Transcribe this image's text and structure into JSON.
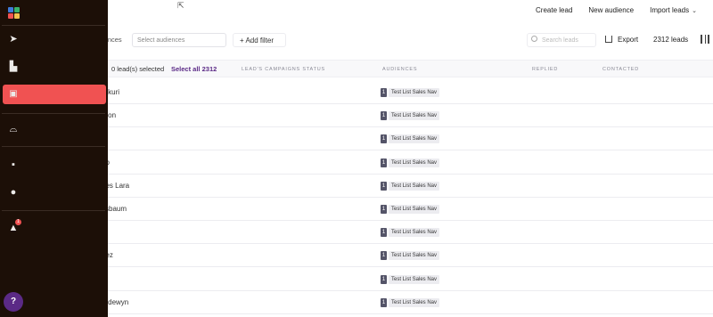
{
  "header": {
    "create_lead": "Create lead",
    "new_audience": "New audience",
    "import_leads": "Import leads"
  },
  "filters": {
    "audiences_tab": "iences",
    "select_placeholder": "Select audiences",
    "add_filter": "+ Add filter",
    "search_placeholder": "Search leads",
    "export": "Export",
    "lead_count": "2312 leads"
  },
  "table": {
    "selected_text": "0 lead(s) selected",
    "select_all": "Select all 2312",
    "columns": [
      "LEAD'S CAMPAIGNS STATUS",
      "AUDIENCES",
      "REPLIED",
      "CONTACTED"
    ],
    "rows": [
      {
        "name": "rukuri",
        "audience_count": "1",
        "audience": "Test List Sales Nav"
      },
      {
        "name": "oron",
        "audience_count": "1",
        "audience": "Test List Sales Nav"
      },
      {
        "name": "s",
        "audience_count": "1",
        "audience": "Test List Sales Nav"
      },
      {
        "name": "ho",
        "audience_count": "1",
        "audience": "Test List Sales Nav"
      },
      {
        "name": "ees Lara",
        "audience_count": "1",
        "audience": "Test List Sales Nav"
      },
      {
        "name": "ssbaum",
        "audience_count": "1",
        "audience": "Test List Sales Nav"
      },
      {
        "name": "e",
        "audience_count": "1",
        "audience": "Test List Sales Nav"
      },
      {
        "name": "dez",
        "audience_count": "1",
        "audience": "Test List Sales Nav"
      },
      {
        "name": "er",
        "audience_count": "1",
        "audience": "Test List Sales Nav"
      },
      {
        "name": "erdewyn",
        "audience_count": "1",
        "audience": "Test List Sales Nav"
      }
    ]
  },
  "sidebar": {
    "icons": [
      "logo-icon",
      "send-icon",
      "chart-icon",
      "contacts-icon",
      "inbox-icon",
      "bot-icon",
      "team-icon",
      "bell-icon"
    ],
    "notification_count": "1",
    "help_label": "?"
  },
  "colors": {
    "sidebar_bg": "#1c0f07",
    "active_item": "#f05252",
    "accent_purple": "#5b2a86"
  }
}
